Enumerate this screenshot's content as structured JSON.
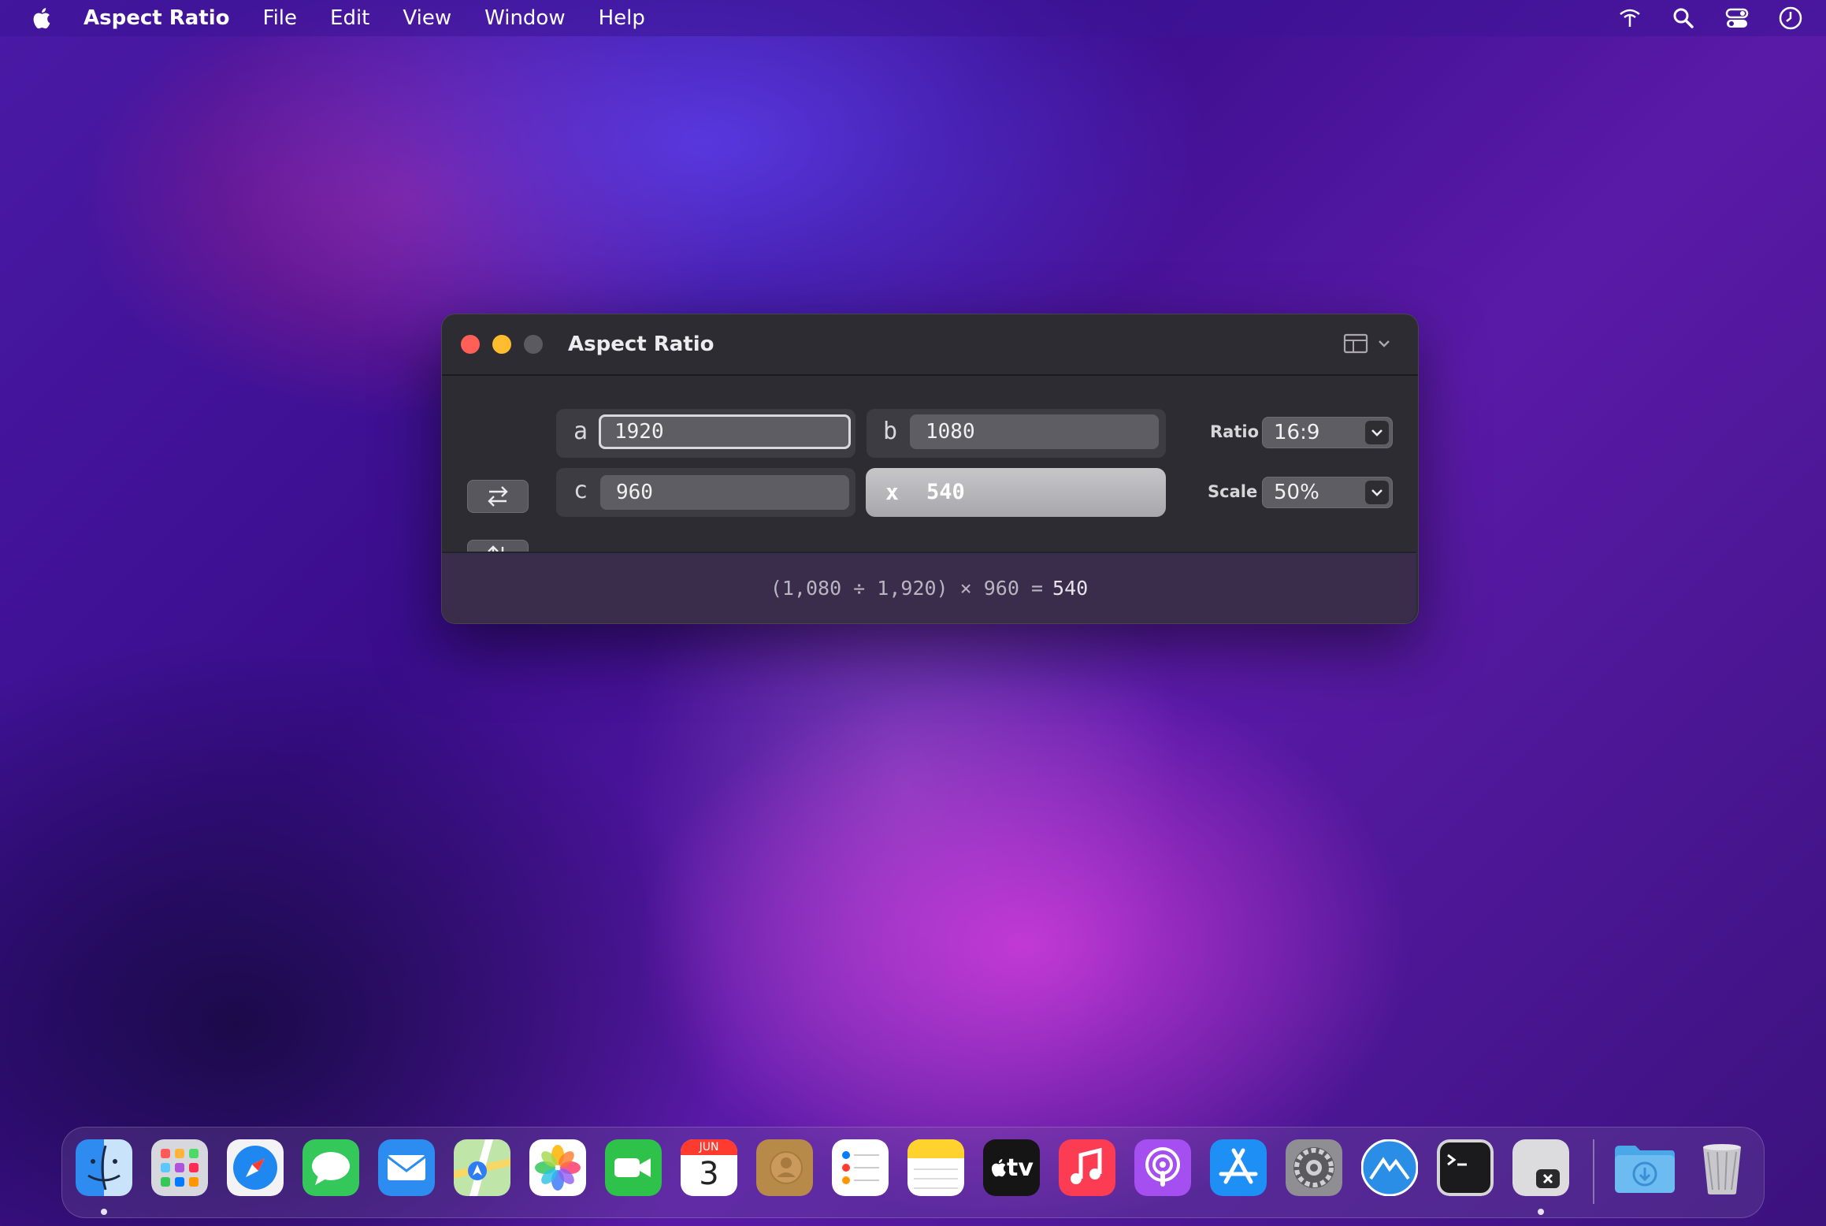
{
  "menubar": {
    "app_name": "Aspect Ratio",
    "items": [
      "File",
      "Edit",
      "View",
      "Window",
      "Help"
    ],
    "status_icons": [
      "wifi-icon",
      "search-icon",
      "control-center-icon",
      "clock-icon"
    ]
  },
  "window": {
    "title": "Aspect Ratio",
    "fields": {
      "a": {
        "letter": "a",
        "value": "1920"
      },
      "b": {
        "letter": "b",
        "value": "1080"
      },
      "c": {
        "letter": "c",
        "value": "960"
      },
      "x": {
        "letter": "x",
        "value": "540"
      }
    },
    "ratio": {
      "label": "Ratio",
      "value": "16:9"
    },
    "scale": {
      "label": "Scale",
      "value": "50%"
    },
    "formula": {
      "expression": "(1,080 ÷ 1,920) × 960 =",
      "result": "540"
    }
  },
  "dock": {
    "apps": [
      "Finder",
      "Launchpad",
      "Safari",
      "Messages",
      "Mail",
      "Maps",
      "Photos",
      "FaceTime",
      "Calendar",
      "Contacts",
      "Reminders",
      "Notes",
      "TV",
      "Music",
      "Podcasts",
      "App Store",
      "System Preferences",
      "Mountain App",
      "Terminal",
      "Aspect Ratio",
      "Downloads",
      "Trash"
    ],
    "calendar": {
      "month": "JUN",
      "day": "3"
    },
    "tv_label": "tv"
  },
  "colors": {
    "close": "#ff5f57",
    "minimize": "#febc2e",
    "zoom_disabled": "#5b5a60",
    "window_bg": "#2e2c33",
    "formula_bg": "#3a2d4c"
  }
}
